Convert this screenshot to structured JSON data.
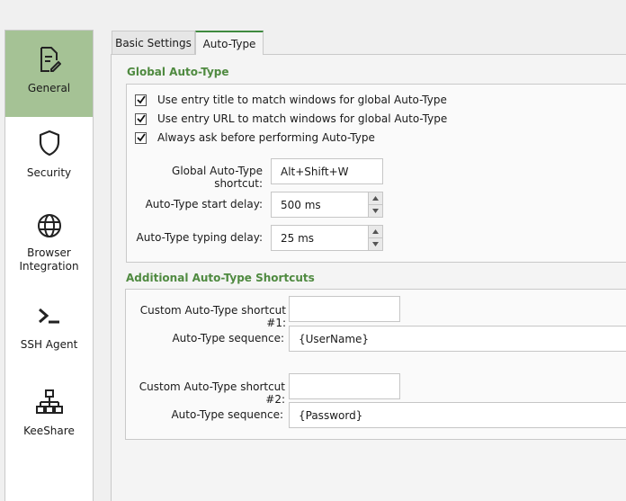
{
  "sidebar": {
    "items": [
      {
        "label": "General",
        "icon": "document-edit-icon"
      },
      {
        "label": "Security",
        "icon": "shield-icon"
      },
      {
        "label": "Browser Integration",
        "label_line1": "Browser",
        "label_line2": "Integration",
        "icon": "globe-icon"
      },
      {
        "label": "SSH Agent",
        "icon": "terminal-icon"
      },
      {
        "label": "KeeShare",
        "icon": "network-icon"
      }
    ],
    "active_index": 0,
    "active_color": "#a5c295"
  },
  "tabs": [
    {
      "label": "Basic Settings",
      "active": false
    },
    {
      "label": "Auto-Type",
      "active": true
    }
  ],
  "global_autotype": {
    "title": "Global Auto-Type",
    "checkboxes": [
      {
        "label": "Use entry title to match windows for global Auto-Type",
        "checked": true
      },
      {
        "label": "Use entry URL to match windows for global Auto-Type",
        "checked": true
      },
      {
        "label": "Always ask before performing Auto-Type",
        "checked": true
      }
    ],
    "shortcut_label": "Global Auto-Type shortcut:",
    "shortcut_value": "Alt+Shift+W",
    "start_delay_label": "Auto-Type start delay:",
    "start_delay_value": "500 ms",
    "typing_delay_label": "Auto-Type typing delay:",
    "typing_delay_value": "25 ms"
  },
  "additional_shortcuts": {
    "title": "Additional Auto-Type Shortcuts",
    "entries": [
      {
        "shortcut_label": "Custom Auto-Type shortcut #1:",
        "shortcut_value": "",
        "sequence_label": "Auto-Type sequence:",
        "sequence_value": "{UserName}"
      },
      {
        "shortcut_label": "Custom Auto-Type shortcut #2:",
        "shortcut_value": "",
        "sequence_label": "Auto-Type sequence:",
        "sequence_value": "{Password}"
      }
    ]
  },
  "colors": {
    "accent": "#4f8a40",
    "tab_indicator": "#3f8a3f"
  }
}
